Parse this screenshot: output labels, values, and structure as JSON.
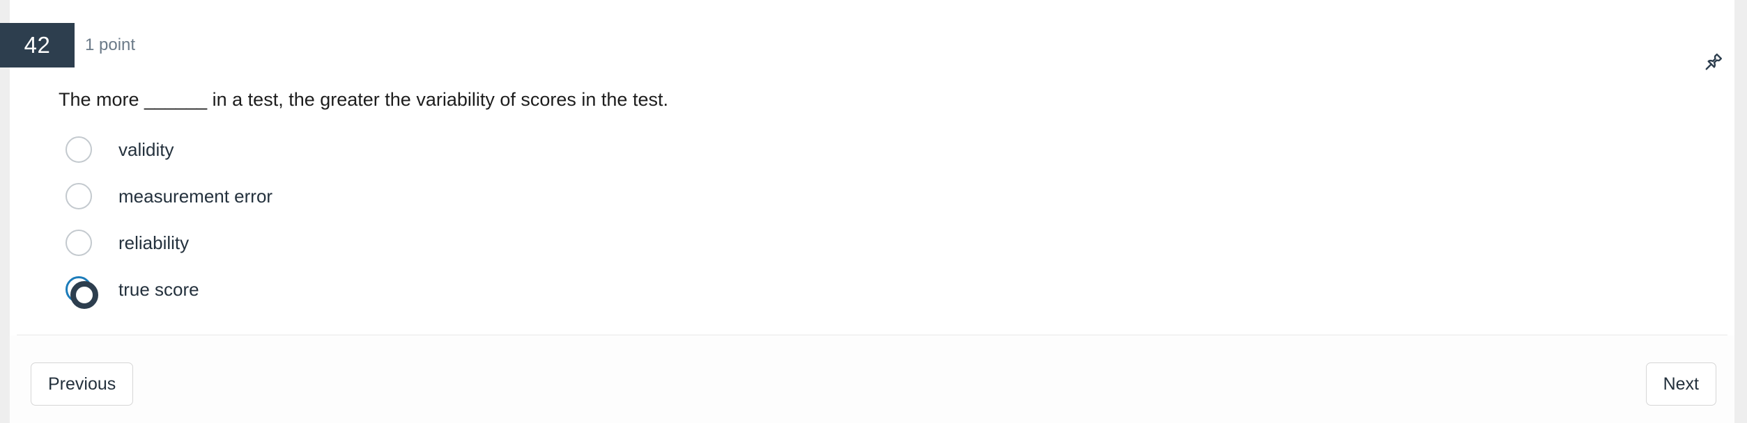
{
  "question": {
    "number": "42",
    "points_label": "1 point",
    "prompt": "The more ______ in a test, the greater the variability of scores in the test.",
    "options": [
      {
        "label": "validity",
        "selected": false
      },
      {
        "label": "measurement error",
        "selected": false
      },
      {
        "label": "reliability",
        "selected": false
      },
      {
        "label": "true score",
        "selected": true
      }
    ]
  },
  "header": {
    "pin_icon": "pushpin-icon"
  },
  "footer": {
    "previous_label": "Previous",
    "next_label": "Next"
  },
  "colors": {
    "badge_background": "#2d3e4e",
    "selected_radio_ring": "#1c7cba",
    "selected_radio_inner": "#2d3e4e",
    "unselected_radio_border": "#c3c9ce",
    "text_primary": "#24313d",
    "text_muted": "#6b7a88",
    "gutter": "#eeeeee"
  }
}
